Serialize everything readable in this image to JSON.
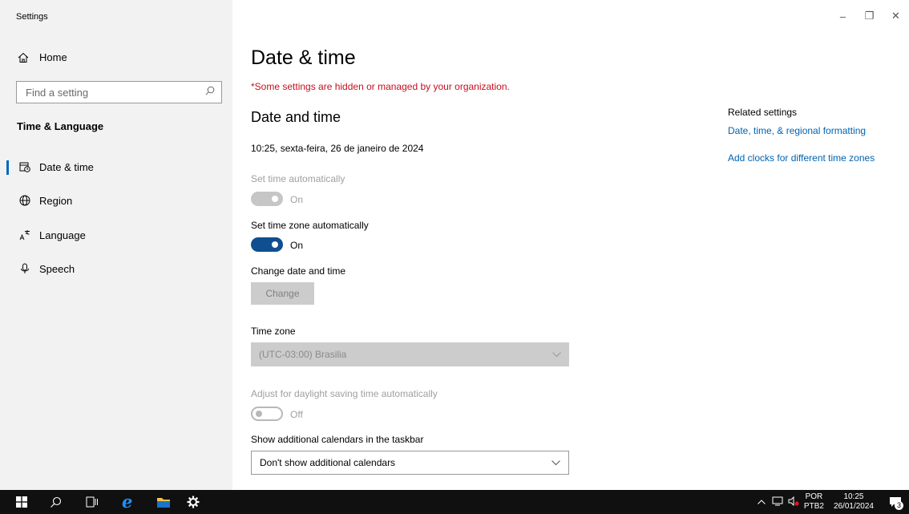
{
  "window": {
    "app_title": "Settings",
    "controls": {
      "minimize": "–",
      "restore": "❐",
      "close": "✕"
    }
  },
  "sidebar": {
    "home_label": "Home",
    "search_placeholder": "Find a setting",
    "section_label": "Time & Language",
    "items": [
      {
        "label": "Date & time",
        "icon": "calendar-clock-icon",
        "selected": true
      },
      {
        "label": "Region",
        "icon": "globe-icon",
        "selected": false
      },
      {
        "label": "Language",
        "icon": "language-icon",
        "selected": false
      },
      {
        "label": "Speech",
        "icon": "microphone-icon",
        "selected": false
      }
    ]
  },
  "main": {
    "title": "Date & time",
    "warning": "*Some settings are hidden or managed by your organization.",
    "subtitle": "Date and time",
    "current_datetime": "10:25, sexta-feira, 26 de janeiro de 2024",
    "set_time_auto": {
      "label": "Set time automatically",
      "state": "On",
      "enabled": false,
      "checked": true
    },
    "set_timezone_auto": {
      "label": "Set time zone automatically",
      "state": "On",
      "enabled": true,
      "checked": true
    },
    "change_date_time": {
      "label": "Change date and time",
      "button": "Change"
    },
    "time_zone": {
      "label": "Time zone",
      "value": "(UTC-03:00) Brasilia"
    },
    "daylight_saving": {
      "label": "Adjust for daylight saving time automatically",
      "state": "Off",
      "enabled": false,
      "checked": false
    },
    "additional_calendars": {
      "label": "Show additional calendars in the taskbar",
      "value": "Don't show additional calendars"
    }
  },
  "related": {
    "heading": "Related settings",
    "links": [
      "Date, time, & regional formatting",
      "Add clocks for different time zones"
    ]
  },
  "taskbar": {
    "language_top": "POR",
    "language_bottom": "PTB2",
    "time": "10:25",
    "date": "26/01/2024",
    "notification_count": "3"
  },
  "colors": {
    "accent": "#0067c0",
    "toggle_on": "#0f4f8f",
    "warning": "#c50f1f",
    "link": "#0063b1"
  }
}
